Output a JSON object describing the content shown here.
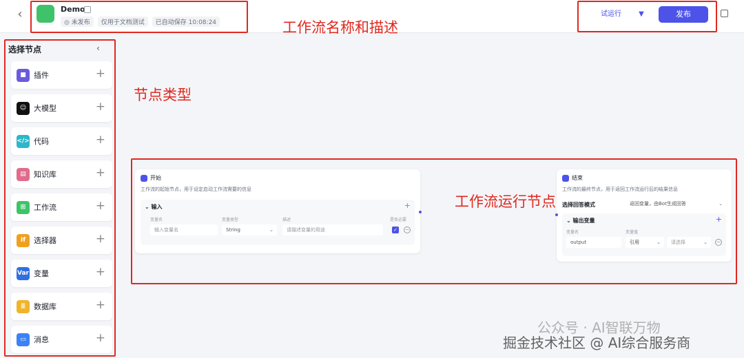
{
  "header": {
    "back_icon": "chevron-left-icon",
    "title": "Demo",
    "status": "◎ 未发布",
    "tag": "仅用于文档测试",
    "autosave": "已自动保存 10:08:24",
    "test_run_label": "试运行",
    "publish_label": "发布"
  },
  "sidebar": {
    "title": "选择节点",
    "items": [
      {
        "label": "插件",
        "icon": "cube-icon",
        "color": "#6a5ae0",
        "glyph": "■"
      },
      {
        "label": "大模型",
        "icon": "llm-icon",
        "color": "#111111",
        "glyph": "☺"
      },
      {
        "label": "代码",
        "icon": "code-icon",
        "color": "#2bb7c9",
        "glyph": "</>"
      },
      {
        "label": "知识库",
        "icon": "book-icon",
        "color": "#e06b8b",
        "glyph": "▤"
      },
      {
        "label": "工作流",
        "icon": "workflow-icon",
        "color": "#3ec36a",
        "glyph": "⊞"
      },
      {
        "label": "选择器",
        "icon": "if-icon",
        "color": "#f0a020",
        "glyph": "If"
      },
      {
        "label": "变量",
        "icon": "var-icon",
        "color": "#2f6fe0",
        "glyph": "Var"
      },
      {
        "label": "数据库",
        "icon": "database-icon",
        "color": "#f0b429",
        "glyph": "≣"
      },
      {
        "label": "消息",
        "icon": "message-icon",
        "color": "#3b82f6",
        "glyph": "▭"
      }
    ]
  },
  "start_node": {
    "title": "开始",
    "desc": "工作流的起始节点，用于设定启动工作流需要的信息",
    "section": "输入",
    "col_name": "变量名",
    "col_type": "变量类型",
    "col_desc": "描述",
    "col_required": "是否必要",
    "name_placeholder": "输入变量名",
    "type_value": "String",
    "desc_placeholder": "请描述变量的用途"
  },
  "end_node": {
    "title": "结束",
    "desc": "工作流的最终节点，用于返回工作流运行后的结果信息",
    "mode_label": "选择回答模式",
    "mode_value": "返回变量，由Bot生成回答",
    "section": "输出变量",
    "col_name": "变量名",
    "col_value": "变量值",
    "output_name": "output",
    "ref_value": "引用",
    "select_placeholder": "请选择"
  },
  "annotations": {
    "name_desc": "工作流名称和描述",
    "node_types": "节点类型",
    "run_nodes": "工作流运行节点"
  },
  "watermark": {
    "line1": "公众号 · AI智联万物",
    "line2": "掘金技术社区 @ AI综合服务商"
  }
}
